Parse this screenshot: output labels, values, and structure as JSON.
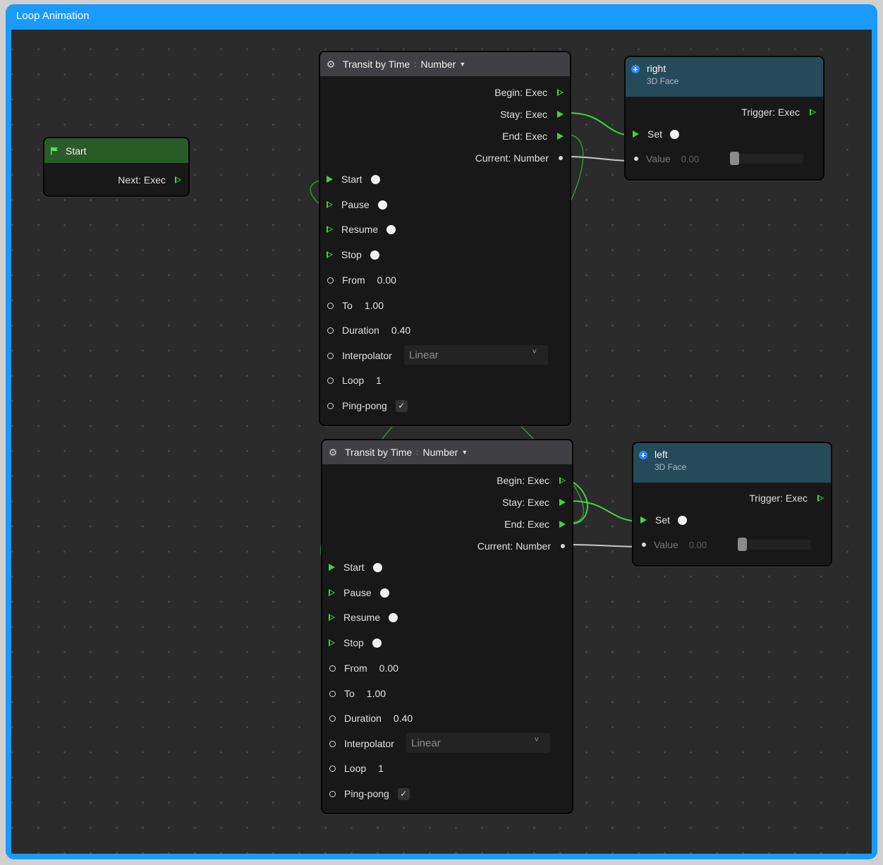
{
  "window": {
    "title": "Loop Animation"
  },
  "colors": {
    "frame": "#1a9bff",
    "exec_wire": "#3fd53f",
    "start_header": "#2a5c2a",
    "face_header": "#254b5b",
    "transit_header": "#404044"
  },
  "start_node": {
    "title": "Start",
    "icon": "flag-icon",
    "output": "Next: Exec"
  },
  "transit_nodes": [
    {
      "title": "Transit by Time",
      "type": "Number",
      "outputs": [
        "Begin: Exec",
        "Stay: Exec",
        "End: Exec",
        "Current: Number"
      ],
      "exec_inputs": [
        "Start",
        "Pause",
        "Resume",
        "Stop"
      ],
      "params": {
        "from_label": "From",
        "from_value": "0.00",
        "to_label": "To",
        "to_value": "1.00",
        "duration_label": "Duration",
        "duration_value": "0.40",
        "interpolator_label": "Interpolator",
        "interpolator_value": "Linear",
        "loop_label": "Loop",
        "loop_value": "1",
        "pingpong_label": "Ping-pong",
        "pingpong_checked": true
      }
    },
    {
      "title": "Transit by Time",
      "type": "Number",
      "outputs": [
        "Begin: Exec",
        "Stay: Exec",
        "End: Exec",
        "Current: Number"
      ],
      "exec_inputs": [
        "Start",
        "Pause",
        "Resume",
        "Stop"
      ],
      "params": {
        "from_label": "From",
        "from_value": "0.00",
        "to_label": "To",
        "to_value": "1.00",
        "duration_label": "Duration",
        "duration_value": "0.40",
        "interpolator_label": "Interpolator",
        "interpolator_value": "Linear",
        "loop_label": "Loop",
        "loop_value": "1",
        "pingpong_label": "Ping-pong",
        "pingpong_checked": true
      }
    }
  ],
  "face_nodes": [
    {
      "title": "right",
      "subtitle": "3D Face",
      "output": "Trigger: Exec",
      "set_label": "Set",
      "value_label": "Value",
      "value": "0.00",
      "slider_level": 0
    },
    {
      "title": "left",
      "subtitle": "3D Face",
      "output": "Trigger: Exec",
      "set_label": "Set",
      "value_label": "Value",
      "value": "0.00",
      "slider_level": 0
    }
  ]
}
